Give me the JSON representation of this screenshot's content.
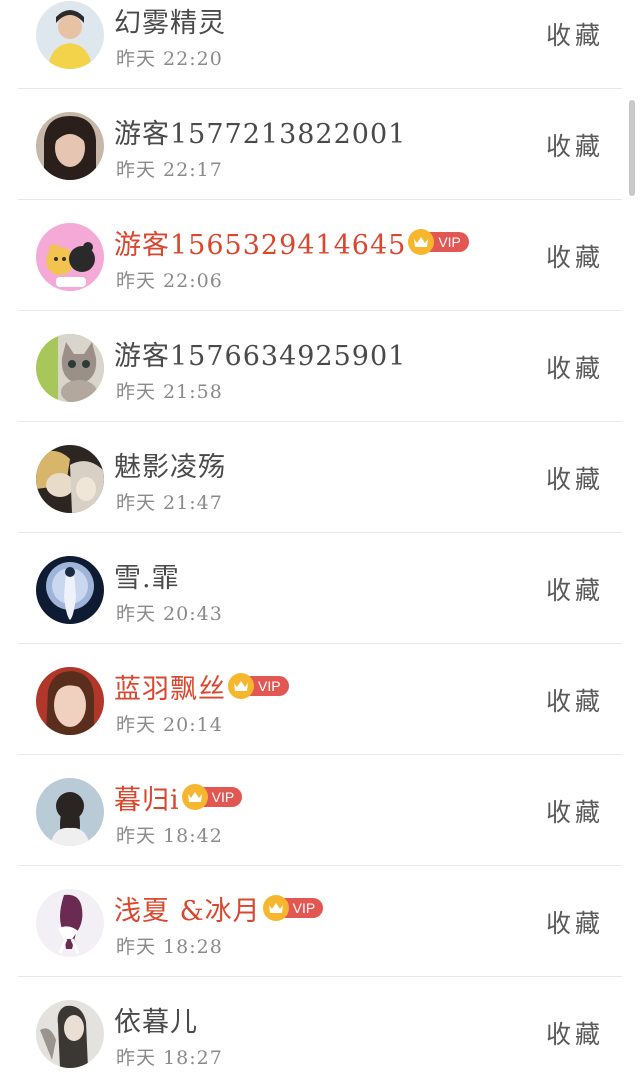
{
  "favorite_label": "收藏",
  "vip_label": "VIP",
  "users": [
    {
      "name": "幻雾精灵",
      "time": "昨天 22:20",
      "vip": false,
      "avatar_icon": "avatar-girl-yellow"
    },
    {
      "name": "游客1577213822001",
      "time": "昨天 22:17",
      "vip": false,
      "avatar_icon": "avatar-girl-portrait"
    },
    {
      "name": "游客1565329414645",
      "time": "昨天 22:06",
      "vip": true,
      "avatar_icon": "avatar-cartoon-bears"
    },
    {
      "name": "游客1576634925901",
      "time": "昨天 21:58",
      "vip": false,
      "avatar_icon": "avatar-kitten"
    },
    {
      "name": "魅影凌殇",
      "time": "昨天 21:47",
      "vip": false,
      "avatar_icon": "avatar-anime-dark"
    },
    {
      "name": "雪.霏",
      "time": "昨天 20:43",
      "vip": false,
      "avatar_icon": "avatar-moon-figure"
    },
    {
      "name": "蓝羽飘丝",
      "time": "昨天 20:14",
      "vip": true,
      "avatar_icon": "avatar-woman-face"
    },
    {
      "name": "暮归i",
      "time": "昨天 18:42",
      "vip": true,
      "avatar_icon": "avatar-girl-back"
    },
    {
      "name": "浅夏 &冰月",
      "time": "昨天 18:28",
      "vip": true,
      "avatar_icon": "avatar-braid-hair"
    },
    {
      "name": "依暮儿",
      "time": "昨天 18:27",
      "vip": false,
      "avatar_icon": "avatar-ink-figure"
    }
  ],
  "colors": {
    "vip_name": "#d9472f",
    "normal_name": "#4a4a4a",
    "time_text": "#8a8a8a",
    "vip_pill": "#e25752",
    "crown": "#f6b72f"
  }
}
